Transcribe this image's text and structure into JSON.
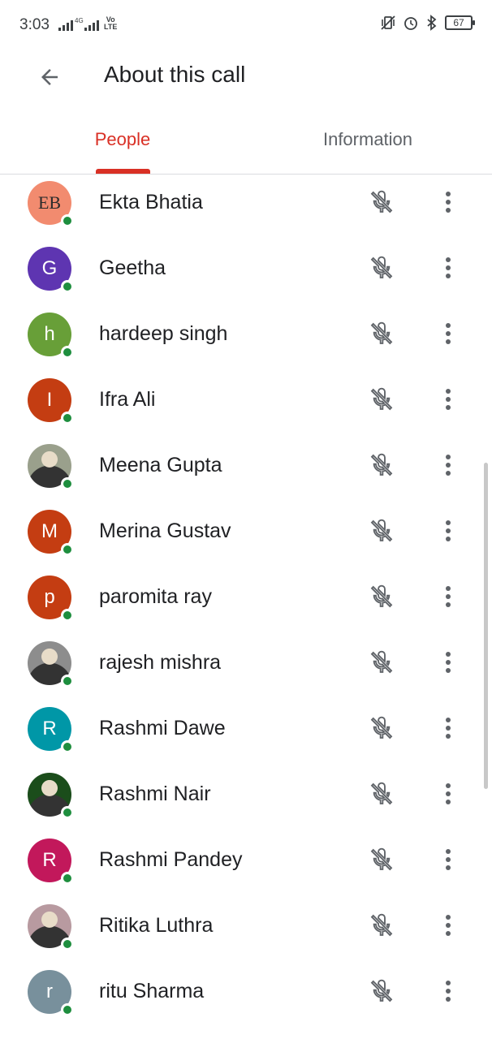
{
  "status_bar": {
    "time": "3:03",
    "network_label": "4G",
    "volte_top": "Vo",
    "volte_bottom": "LTE",
    "battery": "67",
    "icons": [
      "signal-icon",
      "signal-icon",
      "vibrate-icon",
      "alarm-icon",
      "bluetooth-icon",
      "battery-icon"
    ]
  },
  "header": {
    "back_icon": "back-arrow-icon",
    "title": "About this call"
  },
  "tabs": [
    {
      "label": "People",
      "active": true
    },
    {
      "label": "Information",
      "active": false
    }
  ],
  "colors": {
    "accent": "#d93025",
    "online": "#1e8e3e"
  },
  "participants": [
    {
      "name": "Ekta Bhatia",
      "initial": "EB",
      "avatar_color": "#f28b6f",
      "avatar_type": "logo",
      "muted": true
    },
    {
      "name": "Geetha",
      "initial": "G",
      "avatar_color": "#5e35b1",
      "avatar_type": "letter",
      "muted": true
    },
    {
      "name": "hardeep singh",
      "initial": "h",
      "avatar_color": "#689f38",
      "avatar_type": "letter",
      "muted": true
    },
    {
      "name": "Ifra Ali",
      "initial": "I",
      "avatar_color": "#c43d12",
      "avatar_type": "letter",
      "muted": true
    },
    {
      "name": "Meena Gupta",
      "initial": "",
      "avatar_color": "#9aa08c",
      "avatar_type": "photo",
      "muted": true
    },
    {
      "name": "Merina Gustav",
      "initial": "M",
      "avatar_color": "#c43d12",
      "avatar_type": "letter",
      "muted": true
    },
    {
      "name": "paromita ray",
      "initial": "p",
      "avatar_color": "#c43d12",
      "avatar_type": "letter",
      "muted": true
    },
    {
      "name": "rajesh mishra",
      "initial": "",
      "avatar_color": "#8d8d8d",
      "avatar_type": "photo",
      "muted": true
    },
    {
      "name": "Rashmi Dawe",
      "initial": "R",
      "avatar_color": "#0097a7",
      "avatar_type": "letter",
      "muted": true
    },
    {
      "name": "Rashmi Nair",
      "initial": "",
      "avatar_color": "#1b4d1b",
      "avatar_type": "photo",
      "muted": true
    },
    {
      "name": "Rashmi Pandey",
      "initial": "R",
      "avatar_color": "#c2185b",
      "avatar_type": "letter",
      "muted": true
    },
    {
      "name": "Ritika Luthra",
      "initial": "",
      "avatar_color": "#b89aa0",
      "avatar_type": "photo",
      "muted": true
    },
    {
      "name": "ritu Sharma",
      "initial": "r",
      "avatar_color": "#78909c",
      "avatar_type": "letter",
      "muted": true
    }
  ]
}
